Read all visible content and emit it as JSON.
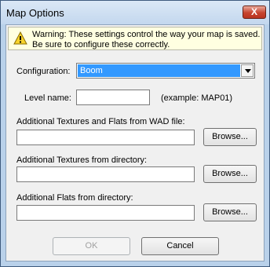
{
  "window": {
    "title": "Map Options",
    "close_label": "X"
  },
  "warning": {
    "icon": "warning-icon",
    "line1": "Warning: These settings control the way your map is saved.",
    "line2": "Be sure to configure these correctly."
  },
  "configuration": {
    "label": "Configuration:",
    "selected": "Boom"
  },
  "level_name": {
    "label": "Level name:",
    "value": "",
    "example": "(example: MAP01)"
  },
  "wad_textures": {
    "label": "Additional Textures and Flats from WAD file:",
    "value": "",
    "browse": "Browse..."
  },
  "dir_textures": {
    "label": "Additional Textures from directory:",
    "value": "",
    "browse": "Browse..."
  },
  "dir_flats": {
    "label": "Additional Flats from directory:",
    "value": "",
    "browse": "Browse..."
  },
  "buttons": {
    "ok": "OK",
    "cancel": "Cancel"
  }
}
